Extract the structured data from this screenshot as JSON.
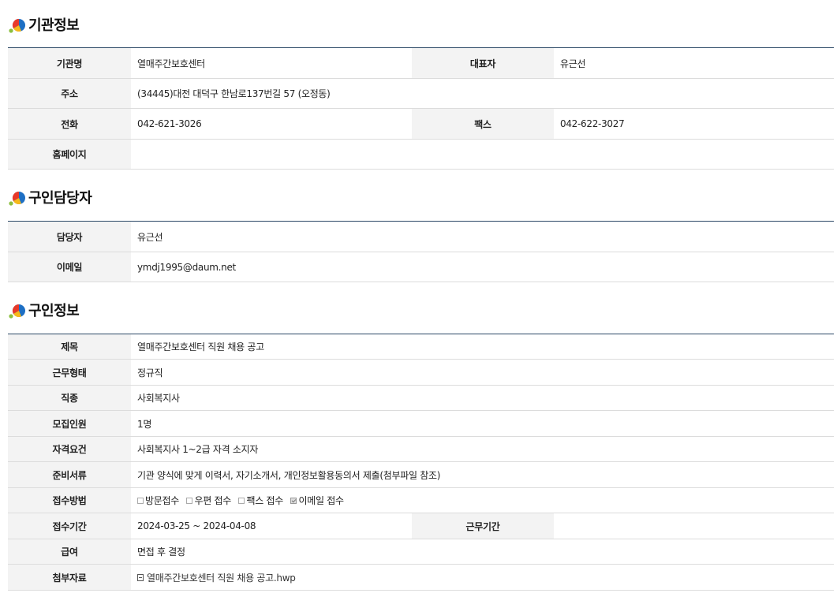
{
  "sections": [
    {
      "title": "기관정보"
    },
    {
      "title": "구인담당자"
    },
    {
      "title": "구인정보"
    }
  ],
  "org": {
    "name_label": "기관명",
    "name": "열매주간보호센터",
    "rep_label": "대표자",
    "rep": "유근선",
    "addr_label": "주소",
    "addr": "(34445)대전 대덕구 한남로137번길 57 (오정동)",
    "phone_label": "전화",
    "phone": "042-621-3026",
    "fax_label": "팩스",
    "fax": "042-622-3027",
    "homepage_label": "홈페이지",
    "homepage": ""
  },
  "contact": {
    "manager_label": "담당자",
    "manager": "유근선",
    "email_label": "이메일",
    "email": "ymdj1995@daum.net"
  },
  "job": {
    "title_label": "제목",
    "title": "열매주간보호센터 직원 채용 공고",
    "type_label": "근무형태",
    "type": "정규직",
    "occupation_label": "직종",
    "occupation": "사회복지사",
    "headcount_label": "모집인원",
    "headcount": "1명",
    "qualification_label": "자격요건",
    "qualification": "사회복지사 1~2급 자격 소지자",
    "documents_label": "준비서류",
    "documents": "기관 양식에 맞게 이력서, 자기소개서, 개인정보활용동의서 제출(첨부파일 참조)",
    "method_label": "접수방법",
    "methods": [
      {
        "label": "방문접수",
        "checked": false
      },
      {
        "label": "우편 접수",
        "checked": false
      },
      {
        "label": "팩스 접수",
        "checked": false
      },
      {
        "label": "이메일 접수",
        "checked": true
      }
    ],
    "period_label": "접수기간",
    "period": "2024-03-25 ~ 2024-04-08",
    "work_period_label": "근무기간",
    "work_period": "",
    "salary_label": "급여",
    "salary": "면접 후 결정",
    "attachment_label": "첨부자료",
    "attachment": "열매주간보호센터 직원 채용 공고.hwp"
  },
  "colors": {
    "table_top_border": "#2b4866",
    "header_bg": "#f3f3f3",
    "row_border": "#dcdcdc",
    "icon_red": "#e83a2a",
    "icon_blue": "#1d6fc4",
    "icon_yellow": "#f6b81a",
    "icon_green": "#8cbf3f"
  }
}
